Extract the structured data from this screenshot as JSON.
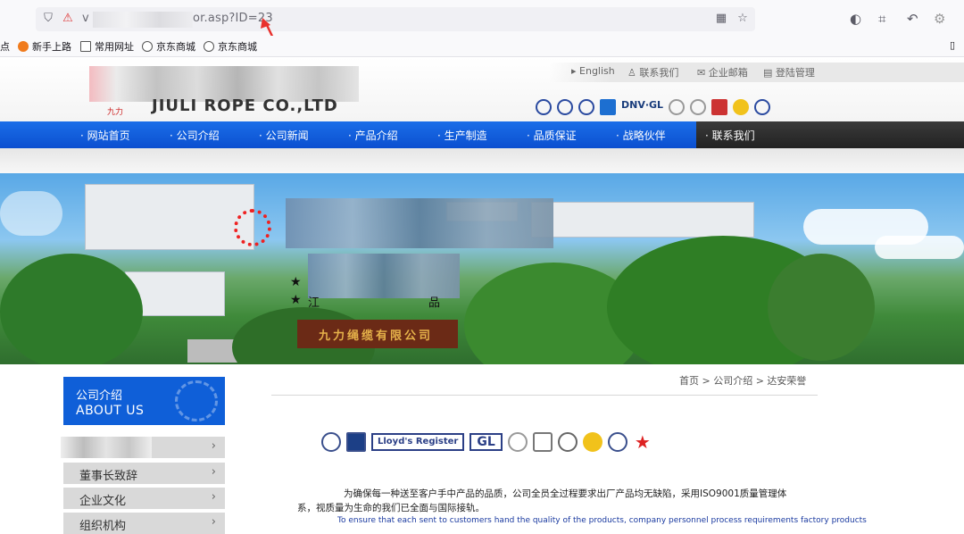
{
  "browser": {
    "url_visible_suffix": "or.asp?ID=23",
    "url_prefix_char": "v",
    "bookmarks": [
      "点",
      "新手上路",
      "常用网址",
      "京东商城",
      "京东商城"
    ]
  },
  "site": {
    "top_links": [
      "English",
      "联系我们",
      "企业邮箱",
      "登陆管理"
    ],
    "logo_mark": "九力",
    "logo_text": "JIULI ROPE CO.,LTD",
    "cert_text": "DNV·GL",
    "nav": [
      "· 网站首页",
      "· 公司介绍",
      "· 公司新闻",
      "· 产品介绍",
      "· 生产制造",
      "· 品质保证",
      "· 战略伙伴",
      "· 联系我们"
    ],
    "banner": {
      "sign": "九力绳缆有限公司",
      "star_lines": [
        "★",
        "★"
      ],
      "star2_suffix": "品",
      "star2_prefix": "江"
    },
    "sidebar": {
      "title": "公司介绍",
      "subtitle": "ABOUT US",
      "items": [
        "董事长致辞",
        "企业文化",
        "组织机构"
      ],
      "arrow": "›"
    },
    "breadcrumb": "首页  >  公司介绍  >  达安荣誉",
    "honor_labels": {
      "lloyds": "Lloyd's Register",
      "gl": "GL"
    },
    "para_cn": "为确保每一种送至客户手中产品的品质，公司全员全过程要求出厂产品均无缺陷，采用ISO9001质量管理体系，视质量为生命的我们已全面与国际接轨。",
    "para_en": "To ensure that each sent to customers hand the quality of the products, company personnel process requirements factory products"
  },
  "colors": {
    "nav_blue": "#0f5fd8",
    "annotation_red": "#e8312d"
  }
}
